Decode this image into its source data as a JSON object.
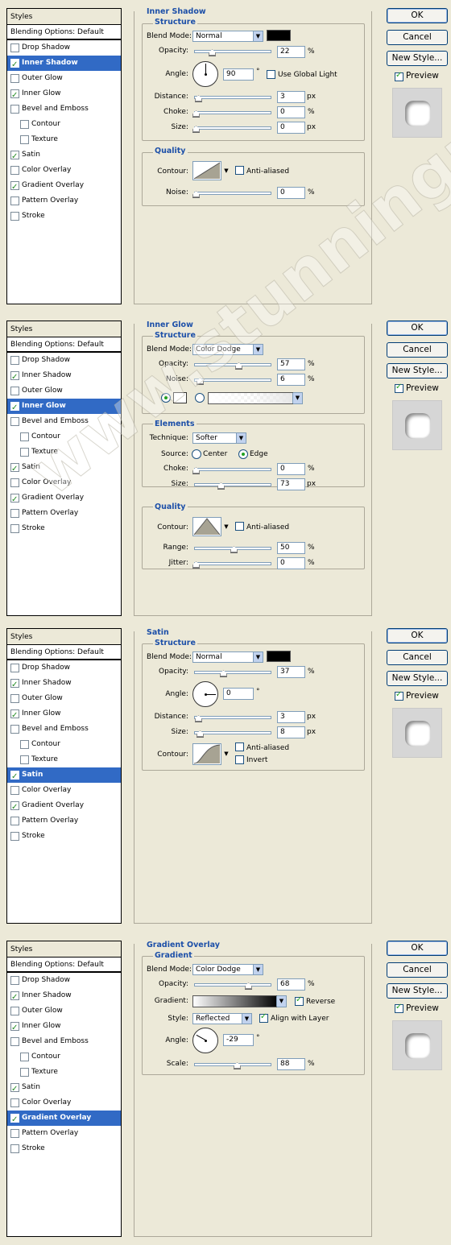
{
  "styles_header": "Styles",
  "blending_options": "Blending Options: Default",
  "layer_styles": [
    "Drop Shadow",
    "Inner Shadow",
    "Outer Glow",
    "Inner Glow",
    "Bevel and Emboss",
    "Contour",
    "Texture",
    "Satin",
    "Color Overlay",
    "Gradient Overlay",
    "Pattern Overlay",
    "Stroke"
  ],
  "buttons": {
    "ok": "OK",
    "cancel": "Cancel",
    "new_style": "New Style...",
    "preview": "Preview"
  },
  "watermark": "www.stunningmesh.com",
  "panels": [
    {
      "selected": "Inner Shadow",
      "checked": [
        "Inner Shadow",
        "Inner Glow",
        "Satin",
        "Gradient Overlay"
      ],
      "title": "Inner Shadow",
      "structure_title": "Structure",
      "quality_title": "Quality",
      "blend_mode_label": "Blend Mode:",
      "blend_mode": "Normal",
      "color": "#000000",
      "opacity_label": "Opacity:",
      "opacity": "22",
      "angle_label": "Angle:",
      "angle": "90",
      "use_global_light": "Use Global Light",
      "use_global_light_checked": false,
      "distance_label": "Distance:",
      "distance": "3",
      "choke_label": "Choke:",
      "choke": "0",
      "size_label": "Size:",
      "size": "0",
      "contour_label": "Contour:",
      "anti_aliased": "Anti-aliased",
      "anti_aliased_checked": false,
      "noise_label": "Noise:",
      "noise": "0",
      "px": "px",
      "pct": "%",
      "deg": "°"
    },
    {
      "selected": "Inner Glow",
      "checked": [
        "Inner Shadow",
        "Inner Glow",
        "Satin",
        "Gradient Overlay"
      ],
      "title": "Inner Glow",
      "structure_title": "Structure",
      "elements_title": "Elements",
      "quality_title": "Quality",
      "blend_mode_label": "Blend Mode:",
      "blend_mode": "Color Dodge",
      "opacity_label": "Opacity:",
      "opacity": "57",
      "noise_label": "Noise:",
      "noise": "6",
      "technique_label": "Technique:",
      "technique": "Softer",
      "source_label": "Source:",
      "source_center": "Center",
      "source_edge": "Edge",
      "source_selected": "Edge",
      "choke_label": "Choke:",
      "choke": "0",
      "size_label": "Size:",
      "size": "73",
      "contour_label": "Contour:",
      "anti_aliased": "Anti-aliased",
      "anti_aliased_checked": false,
      "range_label": "Range:",
      "range": "50",
      "jitter_label": "Jitter:",
      "jitter": "0",
      "px": "px",
      "pct": "%"
    },
    {
      "selected": "Satin",
      "checked": [
        "Inner Shadow",
        "Inner Glow",
        "Satin",
        "Gradient Overlay"
      ],
      "title": "Satin",
      "structure_title": "Structure",
      "blend_mode_label": "Blend Mode:",
      "blend_mode": "Normal",
      "color": "#000000",
      "opacity_label": "Opacity:",
      "opacity": "37",
      "angle_label": "Angle:",
      "angle": "0",
      "distance_label": "Distance:",
      "distance": "3",
      "size_label": "Size:",
      "size": "8",
      "contour_label": "Contour:",
      "anti_aliased": "Anti-aliased",
      "anti_aliased_checked": false,
      "invert": "Invert",
      "invert_checked": false,
      "px": "px",
      "pct": "%",
      "deg": "°"
    },
    {
      "selected": "Gradient Overlay",
      "checked": [
        "Inner Shadow",
        "Inner Glow",
        "Satin",
        "Gradient Overlay"
      ],
      "title": "Gradient Overlay",
      "gradient_title": "Gradient",
      "blend_mode_label": "Blend Mode:",
      "blend_mode": "Color Dodge",
      "opacity_label": "Opacity:",
      "opacity": "68",
      "gradient_label": "Gradient:",
      "reverse": "Reverse",
      "reverse_checked": true,
      "style_label": "Style:",
      "style": "Reflected",
      "align_with_layer": "Align with Layer",
      "align_checked": true,
      "angle_label": "Angle:",
      "angle": "-29",
      "scale_label": "Scale:",
      "scale": "88",
      "pct": "%",
      "deg": "°"
    }
  ],
  "colors": {
    "selection": "#316ac5",
    "section_title": "#1c4fa8",
    "dialog_bg": "#ece9d8",
    "check": "#21a121"
  }
}
